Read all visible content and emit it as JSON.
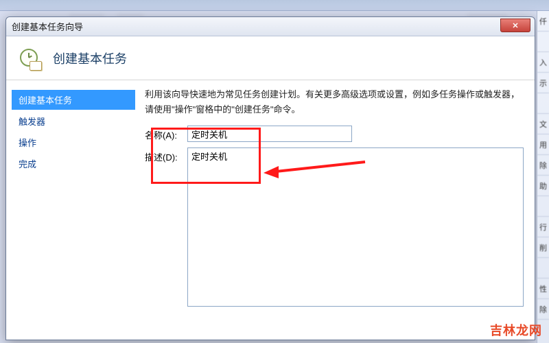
{
  "titlebar": {
    "title": "创建基本任务向导"
  },
  "header": {
    "title": "创建基本任务"
  },
  "sidebar": {
    "steps": [
      {
        "label": "创建基本任务",
        "active": true
      },
      {
        "label": "触发器",
        "active": false
      },
      {
        "label": "操作",
        "active": false
      },
      {
        "label": "完成",
        "active": false
      }
    ]
  },
  "main": {
    "hint": "利用该向导快速地为常见任务创建计划。有关更多高级选项或设置，例如多任务操作或触发器，请使用\"操作\"窗格中的\"创建任务\"命令。",
    "name_label": "名称(A):",
    "name_value": "定时关机",
    "desc_label": "描述(D):",
    "desc_value": "定时关机"
  },
  "watermark": "吉林龙网",
  "close_label": "✕"
}
